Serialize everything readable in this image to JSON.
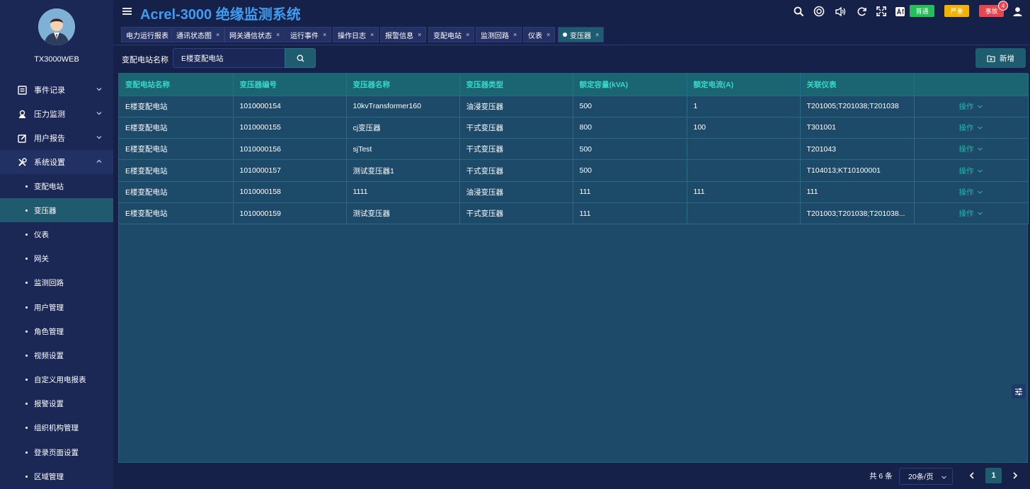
{
  "user": {
    "name": "TX3000WEB"
  },
  "header": {
    "title": "Acrel-3000 绝缘监测系统",
    "level_normal": "普通",
    "level_serious": "严重",
    "level_accident": "事故",
    "accident_count": "4",
    "colors": {
      "normal": "#21c05a",
      "serious": "#f2b205",
      "accident": "#e8454f",
      "title": "#3f9cf0"
    }
  },
  "sidebar": {
    "menus": [
      {
        "label": "事件记录",
        "icon": "event-record-icon"
      },
      {
        "label": "压力监测",
        "icon": "pressure-monitor-icon"
      },
      {
        "label": "用户报告",
        "icon": "user-report-icon"
      },
      {
        "label": "系统设置",
        "icon": "settings-tools-icon"
      }
    ],
    "sub_items": [
      {
        "label": "变配电站"
      },
      {
        "label": "变压器"
      },
      {
        "label": "仪表"
      },
      {
        "label": "网关"
      },
      {
        "label": "监测回路"
      },
      {
        "label": "用户管理"
      },
      {
        "label": "角色管理"
      },
      {
        "label": "视频设置"
      },
      {
        "label": "自定义用电报表"
      },
      {
        "label": "报警设置"
      },
      {
        "label": "组织机构管理"
      },
      {
        "label": "登录页面设置"
      },
      {
        "label": "区域管理"
      }
    ]
  },
  "tabs": [
    {
      "label": "电力运行报表"
    },
    {
      "label": "通讯状态图"
    },
    {
      "label": "网关通信状态"
    },
    {
      "label": "运行事件"
    },
    {
      "label": "操作日志"
    },
    {
      "label": "报警信息"
    },
    {
      "label": "变配电站"
    },
    {
      "label": "监测回路"
    },
    {
      "label": "仪表"
    },
    {
      "label": "变压器"
    }
  ],
  "filter": {
    "label": "变配电站名称",
    "value": "E楼变配电站",
    "add_label": "新增"
  },
  "table": {
    "columns": [
      "变配电站名称",
      "变压器编号",
      "变压器名称",
      "变压器类型",
      "额定容量(kVA)",
      "额定电流(A)",
      "关联仪表",
      ""
    ],
    "op_label": "操作",
    "rows": [
      [
        "E楼变配电站",
        "1010000154",
        "10kvTransformer160",
        "油浸变压器",
        "500",
        "1",
        "T201005;T201038;T201038"
      ],
      [
        "E楼变配电站",
        "1010000155",
        "cj变压器",
        "干式变压器",
        "800",
        "100",
        "T301001"
      ],
      [
        "E楼变配电站",
        "1010000156",
        "sjTest",
        "干式变压器",
        "500",
        "",
        "T201043"
      ],
      [
        "E楼变配电站",
        "1010000157",
        "测试变压器1",
        "干式变压器",
        "500",
        "",
        "T104013;KT10100001"
      ],
      [
        "E楼变配电站",
        "1010000158",
        "1111",
        "油浸变压器",
        "111",
        "111",
        "111"
      ],
      [
        "E楼变配电站",
        "1010000159",
        "测试变压器",
        "干式变压器",
        "111",
        "",
        "T201003;T201038;T201038..."
      ]
    ]
  },
  "pagination": {
    "total": "共 6 条",
    "page_size": "20条/页",
    "current": "1"
  }
}
